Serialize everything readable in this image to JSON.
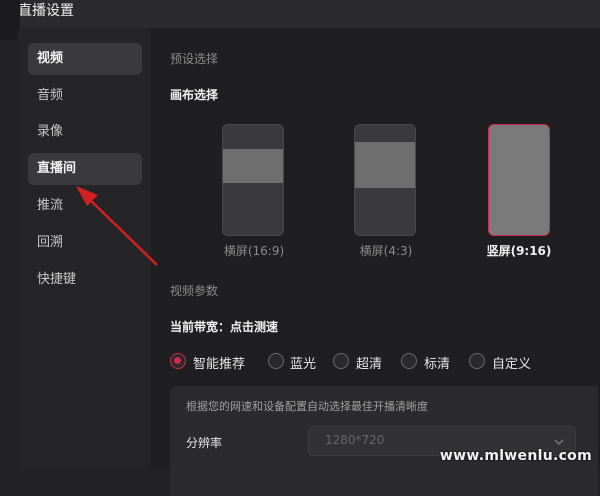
{
  "window": {
    "title": "直播设置"
  },
  "sidebar": {
    "items": [
      {
        "label": "视频",
        "state": "active"
      },
      {
        "label": "音频",
        "state": "normal"
      },
      {
        "label": "录像",
        "state": "normal"
      },
      {
        "label": "直播间",
        "state": "hover"
      },
      {
        "label": "推流",
        "state": "normal"
      },
      {
        "label": "回溯",
        "state": "normal"
      },
      {
        "label": "快捷键",
        "state": "normal"
      }
    ]
  },
  "presets": {
    "section_label": "预设选择",
    "canvas_label": "画布选择",
    "options": [
      {
        "label": "横屏(16:9)",
        "selected": false
      },
      {
        "label": "横屏(4:3)",
        "selected": false
      },
      {
        "label": "竖屏(9:16)",
        "selected": true
      }
    ]
  },
  "video_params": {
    "section_label": "视频参数",
    "bandwidth_label": "当前带宽：点击测速",
    "quality_options": [
      {
        "label": "智能推荐",
        "checked": true
      },
      {
        "label": "蓝光",
        "checked": false
      },
      {
        "label": "超清",
        "checked": false
      },
      {
        "label": "标清",
        "checked": false
      },
      {
        "label": "自定义",
        "checked": false
      }
    ],
    "hint": "根据您的网速和设备配置自动选择最佳开播清晰度",
    "resolution_label": "分辨率",
    "resolution_value": "1280*720"
  },
  "annotation": {
    "arrow_color": "#d42020"
  },
  "watermark": "www.mlwenlu.com",
  "colors": {
    "accent": "#d02a4d",
    "background": "#1f1f21"
  }
}
